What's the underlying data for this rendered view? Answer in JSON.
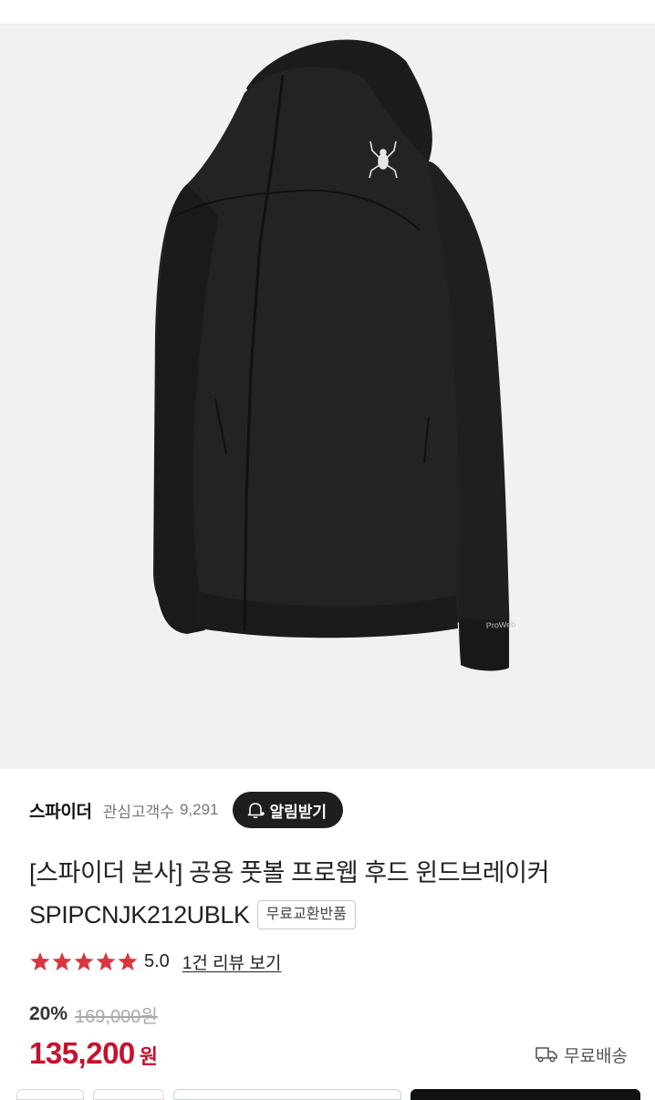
{
  "product_image": {
    "alt": "black hooded windbreaker jacket",
    "logo_text": "ProWeb"
  },
  "brand": {
    "name": "스파이더",
    "favorites_label": "관심고객수",
    "favorites_count": "9,291",
    "alarm_button": "알림받기"
  },
  "product": {
    "title_line1": "[스파이더 본사] 공용 풋볼 프로웹 후드 윈드브레이커",
    "title_line2": "SPIPCNJK212UBLK",
    "badge": "무료교환반품"
  },
  "rating": {
    "stars": 5,
    "value": "5.0",
    "review_link": "1건 리뷰 보기"
  },
  "pricing": {
    "discount": "20%",
    "original_price": "169,000원",
    "price": "135,200",
    "currency": "원"
  },
  "shipping": {
    "label": "무료배송"
  },
  "colors": {
    "price_red": "#c8102e",
    "star_red": "#d9363e",
    "dark_button": "#1e1e1e",
    "hero_bg": "#f1f1f1"
  },
  "icons": [
    "bell-plus-icon",
    "star-icon",
    "truck-icon",
    "spider-logo-icon"
  ]
}
